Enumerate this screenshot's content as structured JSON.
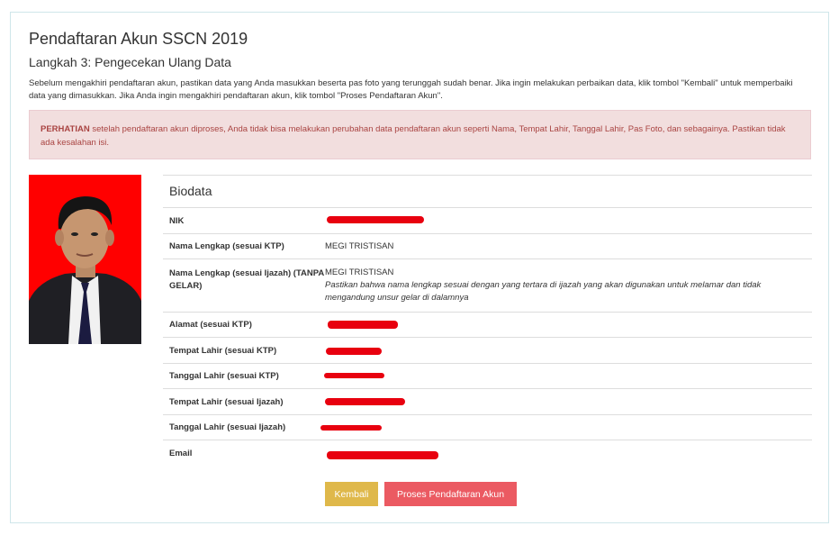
{
  "page": {
    "title": "Pendaftaran Akun SSCN 2019",
    "step_title": "Langkah 3: Pengecekan Ulang Data",
    "instructions": "Sebelum mengakhiri pendaftaran akun, pastikan data yang Anda masukkan beserta pas foto yang terunggah sudah benar. Jika ingin melakukan perbaikan data, klik tombol \"Kembali\" untuk memperbaiki data yang dimasukkan. Jika Anda ingin mengakhiri pendaftaran akun, klik tombol \"Proses Pendaftaran Akun\"."
  },
  "alert": {
    "strong": "PERHATIAN",
    "text": " setelah pendaftaran akun diproses, Anda tidak bisa melakukan perubahan data pendaftaran akun seperti Nama, Tempat Lahir, Tanggal Lahir, Pas Foto, dan sebagainya. Pastikan tidak ada kesalahan isi.",
    "colors": {
      "background": "#f2dede",
      "text": "#a94442"
    }
  },
  "biodata": {
    "title": "Biodata",
    "rows": [
      {
        "label": "NIK",
        "value": "",
        "redacted": true
      },
      {
        "label": "Nama Lengkap (sesuai KTP)",
        "value": "MEGI TRISTISAN"
      },
      {
        "label": "Nama Lengkap (sesuai Ijazah) (TANPA GELAR)",
        "value": "MEGI TRISTISAN",
        "note": "Pastikan bahwa nama lengkap sesuai dengan yang tertara di ijazah yang akan digunakan untuk melamar dan tidak mengandung unsur gelar di dalamnya"
      },
      {
        "label": "Alamat (sesuai KTP)",
        "value": "",
        "redacted": true
      },
      {
        "label": "Tempat Lahir (sesuai KTP)",
        "value": "",
        "redacted": true
      },
      {
        "label": "Tanggal Lahir (sesuai KTP)",
        "value": "",
        "redacted": true
      },
      {
        "label": "Tempat Lahir (sesuai Ijazah)",
        "value": "",
        "redacted": true
      },
      {
        "label": "Tanggal Lahir (sesuai Ijazah)",
        "value": "",
        "redacted": true
      },
      {
        "label": "Email",
        "value": "",
        "redacted": true
      }
    ]
  },
  "photo": {
    "icon": "applicant-photo",
    "background": "#ff0000"
  },
  "buttons": {
    "back_label": "Kembali",
    "submit_label": "Proses Pendaftaran Akun",
    "back_color": "#dfb84a",
    "submit_color": "#eb5a62"
  }
}
